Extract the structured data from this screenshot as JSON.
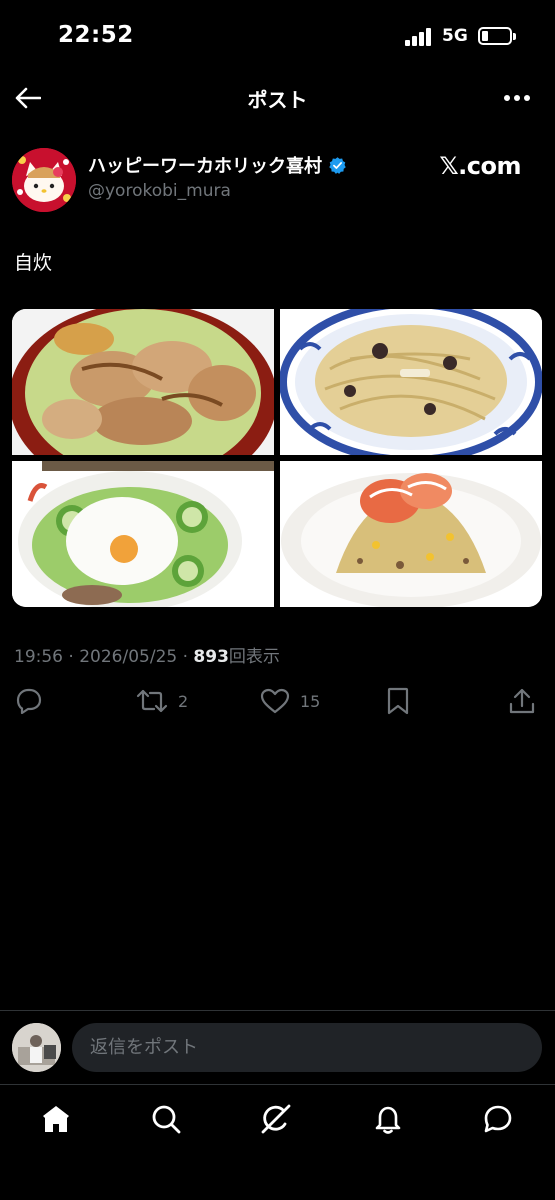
{
  "status_bar": {
    "time": "22:52",
    "network": "5G",
    "battery_level": 0.2
  },
  "header": {
    "title": "ポスト",
    "back_icon": "back-arrow-icon",
    "more_icon": "more-horizontal-icon"
  },
  "post": {
    "author": {
      "display_name": "ハッピーワーカホリック喜村",
      "handle": "@yorokobi_mura",
      "verified": true
    },
    "brand": "𝕏.com",
    "text": "自炊",
    "media": [
      {
        "alt": "rice bowl with grilled chicken"
      },
      {
        "alt": "pasta with mushrooms"
      },
      {
        "alt": "bowl with soft-boiled egg and cucumber"
      },
      {
        "alt": "fried rice with crab"
      }
    ],
    "time": "19:56",
    "date": "2026/05/25",
    "separator": "·",
    "views_count": "893",
    "views_label": "回表示",
    "actions": {
      "reply_count": "",
      "repost_count": "2",
      "like_count": "15"
    }
  },
  "reply": {
    "placeholder": "返信をポスト"
  },
  "tabs": [
    "home",
    "search",
    "grok",
    "notifications",
    "messages"
  ],
  "colors": {
    "background": "#000000",
    "text": "#e7e9ea",
    "muted": "#71767b",
    "verified": "#1d9bf0",
    "border": "#2f3336"
  }
}
